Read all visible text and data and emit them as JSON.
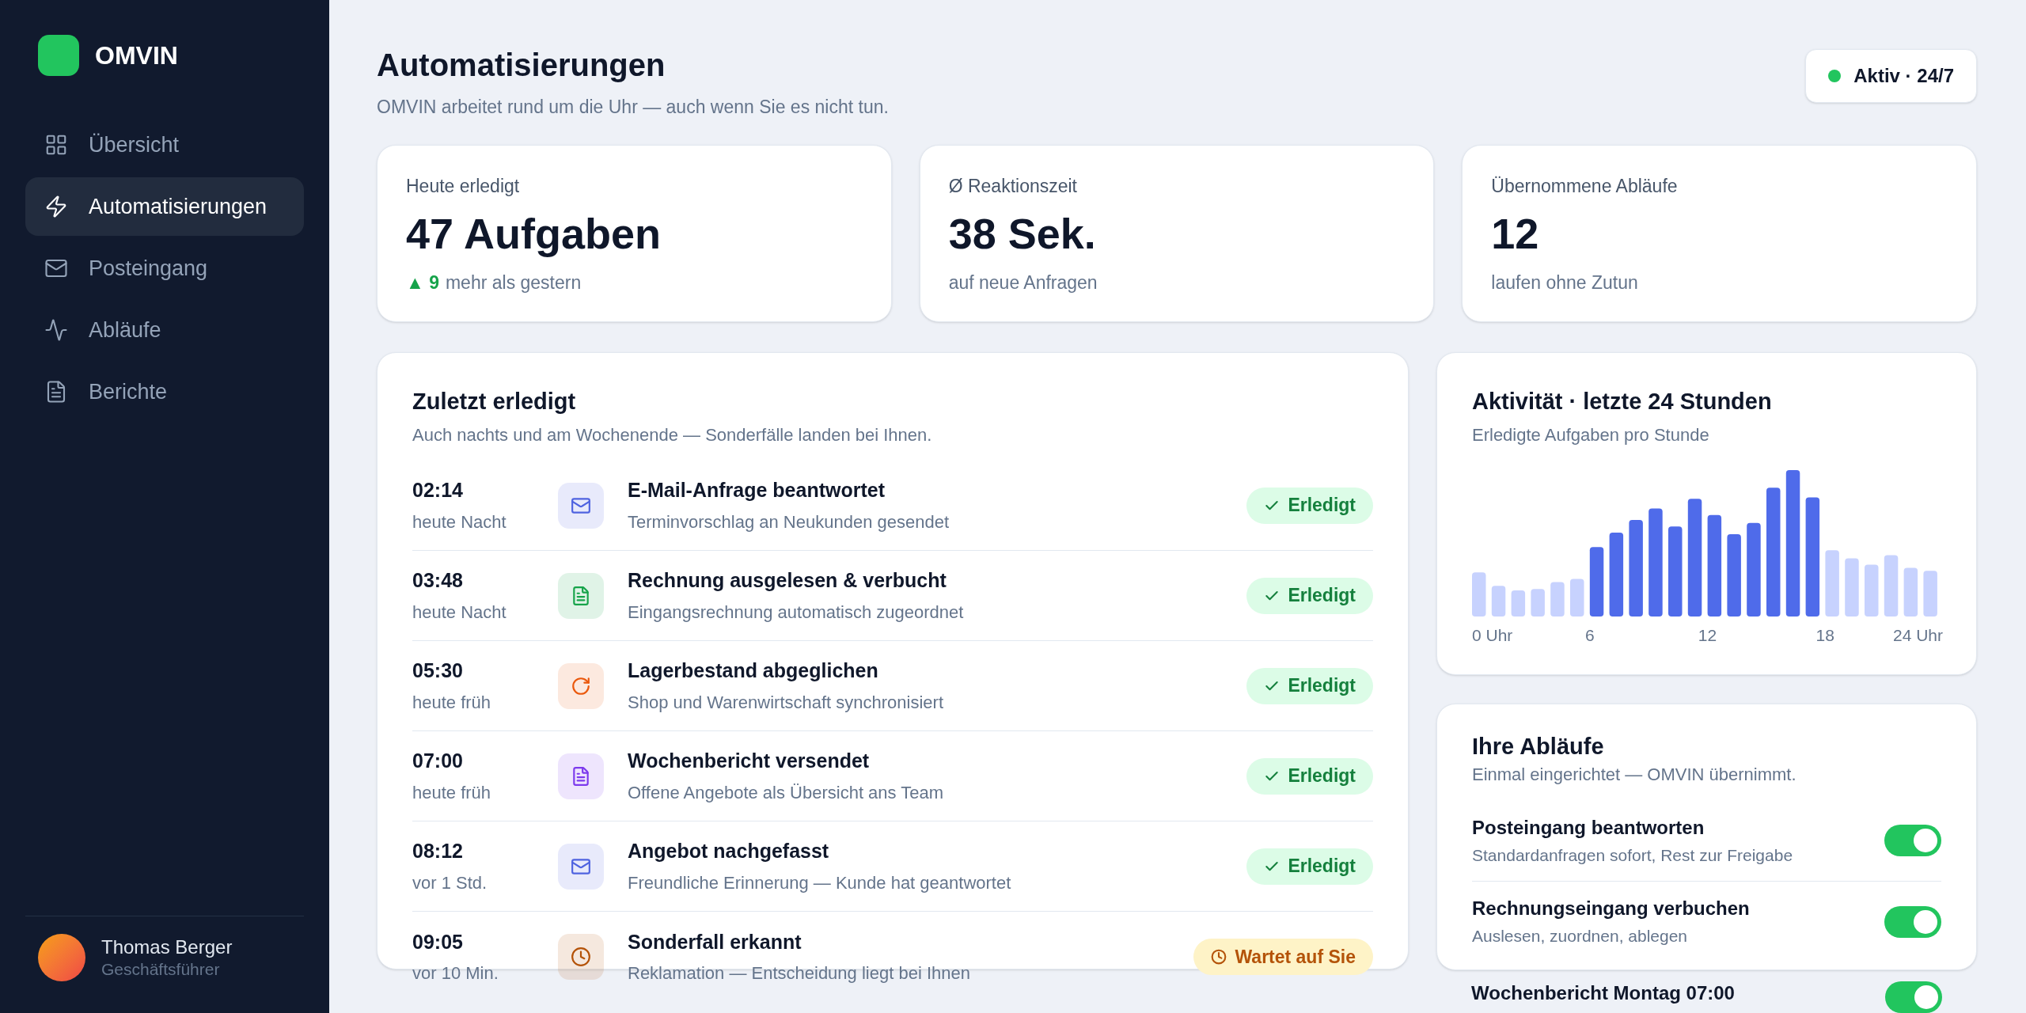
{
  "sidebar": {
    "brand": "OMVIN",
    "items": [
      {
        "kind": "grid",
        "label": "Übersicht",
        "selected": false
      },
      {
        "kind": "bolt",
        "label": "Automatisierungen",
        "selected": true
      },
      {
        "kind": "mail",
        "label": "Posteingang",
        "selected": false
      },
      {
        "kind": "wave",
        "label": "Abläufe",
        "selected": false
      },
      {
        "kind": "report",
        "label": "Berichte",
        "selected": false
      }
    ],
    "user": {
      "name": "Thomas Berger",
      "role": "Geschäftsführer"
    }
  },
  "header": {
    "title": "Automatisierungen",
    "subtitle": "OMVIN arbeitet rund um die Uhr — auch wenn Sie es nicht tun.",
    "status": {
      "label": "Aktiv · 24/7",
      "online": true
    }
  },
  "stats": [
    {
      "label": "Heute erledigt",
      "value": "47 Aufgaben",
      "delta": "▲ 9",
      "note": "mehr als gestern"
    },
    {
      "label": "Ø Reaktionszeit",
      "value": "38 Sek.",
      "note": "auf neue Anfragen"
    },
    {
      "label": "Übernommene Abläufe",
      "value": "12",
      "note": "laufen ohne Zutun"
    }
  ],
  "recent": {
    "title": "Zuletzt erledigt",
    "subtitle": "Auch nachts und am Wochenende — Sonderfälle landen bei Ihnen.",
    "rows": [
      {
        "time": "02:14",
        "when": "heute Nacht",
        "kind": "mail",
        "color": "#4f63e0",
        "title": "E-Mail-Anfrage beantwortet",
        "detail": "Terminvorschlag an Neukunden gesendet",
        "waiting": false,
        "badge": "Erledigt"
      },
      {
        "time": "03:48",
        "when": "heute Nacht",
        "kind": "document",
        "color": "#16a34a",
        "title": "Rechnung ausgelesen & verbucht",
        "detail": "Eingangsrechnung automatisch zugeordnet",
        "waiting": false,
        "badge": "Erledigt"
      },
      {
        "time": "05:30",
        "when": "heute früh",
        "kind": "refresh",
        "color": "#ea580c",
        "title": "Lagerbestand abgeglichen",
        "detail": "Shop und Warenwirtschaft synchronisiert",
        "waiting": false,
        "badge": "Erledigt"
      },
      {
        "time": "07:00",
        "when": "heute früh",
        "kind": "document",
        "color": "#7c3aed",
        "title": "Wochenbericht versendet",
        "detail": "Offene Angebote als Übersicht ans Team",
        "waiting": false,
        "badge": "Erledigt"
      },
      {
        "time": "08:12",
        "when": "vor 1 Std.",
        "kind": "mail",
        "color": "#4f63e0",
        "title": "Angebot nachgefasst",
        "detail": "Freundliche Erinnerung — Kunde hat geantwortet",
        "waiting": false,
        "badge": "Erledigt"
      },
      {
        "time": "09:05",
        "when": "vor 10 Min.",
        "kind": "clock",
        "color": "#b45309",
        "title": "Sonderfall erkannt",
        "detail": "Reklamation — Entscheidung liegt bei Ihnen",
        "waiting": true,
        "badge": "Wartet auf Sie"
      }
    ]
  },
  "activity": {
    "title": "Aktivität · letzte 24 Stunden",
    "subtitle": "Erledigte Aufgaben pro Stunde",
    "axis_labels": [
      "0 Uhr",
      "6",
      "12",
      "18",
      "24 Uhr"
    ]
  },
  "flows": {
    "title": "Ihre Abläufe",
    "subtitle": "Einmal eingerichtet — OMVIN übernimmt.",
    "items": [
      {
        "title": "Posteingang beantworten",
        "detail": "Standardanfragen sofort, Rest zur Freigabe",
        "on": true
      },
      {
        "title": "Rechnungseingang verbuchen",
        "detail": "Auslesen, zuordnen, ablegen",
        "on": true
      },
      {
        "title": "Wochenbericht Montag 07:00",
        "on": true
      }
    ]
  }
}
